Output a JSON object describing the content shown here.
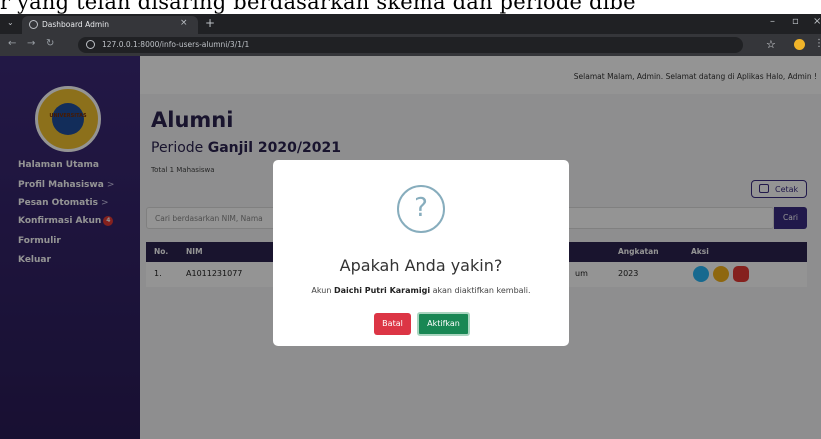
{
  "caption": "r yang telah disaring berdasarkan skema dan periode dibe",
  "browser": {
    "tab_title": "Dashboard Admin",
    "tab_close": "×",
    "new_tab": "+",
    "url": "127.0.0.1:8000/info-users-alumni/3/1/1"
  },
  "sidebar": {
    "logo_text": "UNIVERSITAS",
    "items": [
      {
        "label": "Halaman Utama",
        "chevron": ""
      },
      {
        "label": "Profil Mahasiswa",
        "chevron": ">"
      },
      {
        "label": "Pesan Otomatis",
        "chevron": ">"
      },
      {
        "label": "Konfirmasi Akun",
        "badge": "4"
      },
      {
        "label": "Formulir",
        "chevron": ""
      },
      {
        "label": "Keluar",
        "chevron": ""
      }
    ]
  },
  "header": {
    "greeting": "Selamat Malam, Admin. Selamat datang di Aplikas  Halo, Admin !"
  },
  "main": {
    "title": "Alumni",
    "periode_prefix": "Periode ",
    "periode_value": "Ganjil 2020/2021",
    "total": "Total 1 Mahasiswa",
    "print_label": "Cetak",
    "search_placeholder": "Cari berdasarkan NIM, Nama",
    "search_button": "Cari",
    "table": {
      "headers": [
        "No.",
        "NIM",
        "Angkatan",
        "Aksi"
      ],
      "rows": [
        {
          "no": "1.",
          "nim": "A1011231077",
          "partial": "um",
          "angkatan": "2023"
        }
      ]
    }
  },
  "modal": {
    "icon": "?",
    "title": "Apakah Anda yakin?",
    "text_before": "Akun ",
    "name": "Daichi Putri Karamigi",
    "text_after": " akan diaktifkan kembali.",
    "cancel": "Batal",
    "confirm": "Aktifkan"
  },
  "colors": {
    "sidebar": "#3c2a78",
    "table_header": "#2b2350",
    "danger": "#dc3545",
    "success": "#198754",
    "action_view": "#29b6f6",
    "action_edit": "#f5b21b",
    "action_delete": "#e53935"
  }
}
